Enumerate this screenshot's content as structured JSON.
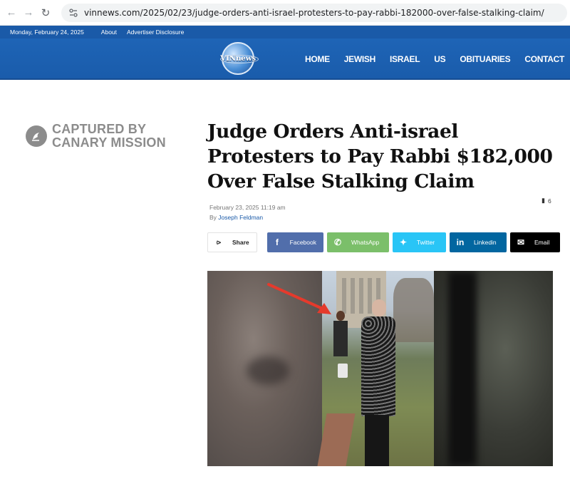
{
  "browser": {
    "url": "vinnews.com/2025/02/23/judge-orders-anti-israel-protesters-to-pay-rabbi-182000-over-false-stalking-claim/"
  },
  "top_strip": {
    "date": "Monday, February 24, 2025",
    "about": "About",
    "advertiser": "Advertiser Disclosure"
  },
  "header": {
    "logo_text": "VINnews",
    "menu": [
      "HOME",
      "JEWISH",
      "ISRAEL",
      "US",
      "OBITUARIES",
      "CONTACT"
    ]
  },
  "promo": {
    "line1": "CAPTURED BY",
    "line2": "CANARY MISSION"
  },
  "article": {
    "title": "Judge Orders Anti-israel Protesters to Pay Rabbi $182,000 Over False Stalking Claim",
    "date": "February 23, 2025 11:19 am",
    "by_label": "By",
    "author": "Joseph Feldman",
    "comment_count": "6"
  },
  "share": {
    "share_label": "Share",
    "buttons": [
      "Facebook",
      "WhatsApp",
      "Twitter",
      "Linkedin",
      "Email"
    ]
  },
  "colors": {
    "brand_blue": "#1a5aa8",
    "facebook": "#516eab",
    "whatsapp": "#7bbf6a",
    "twitter": "#29c5f6",
    "linkedin": "#0266a0",
    "email": "#000000",
    "arrow_red": "#e53a2c"
  }
}
